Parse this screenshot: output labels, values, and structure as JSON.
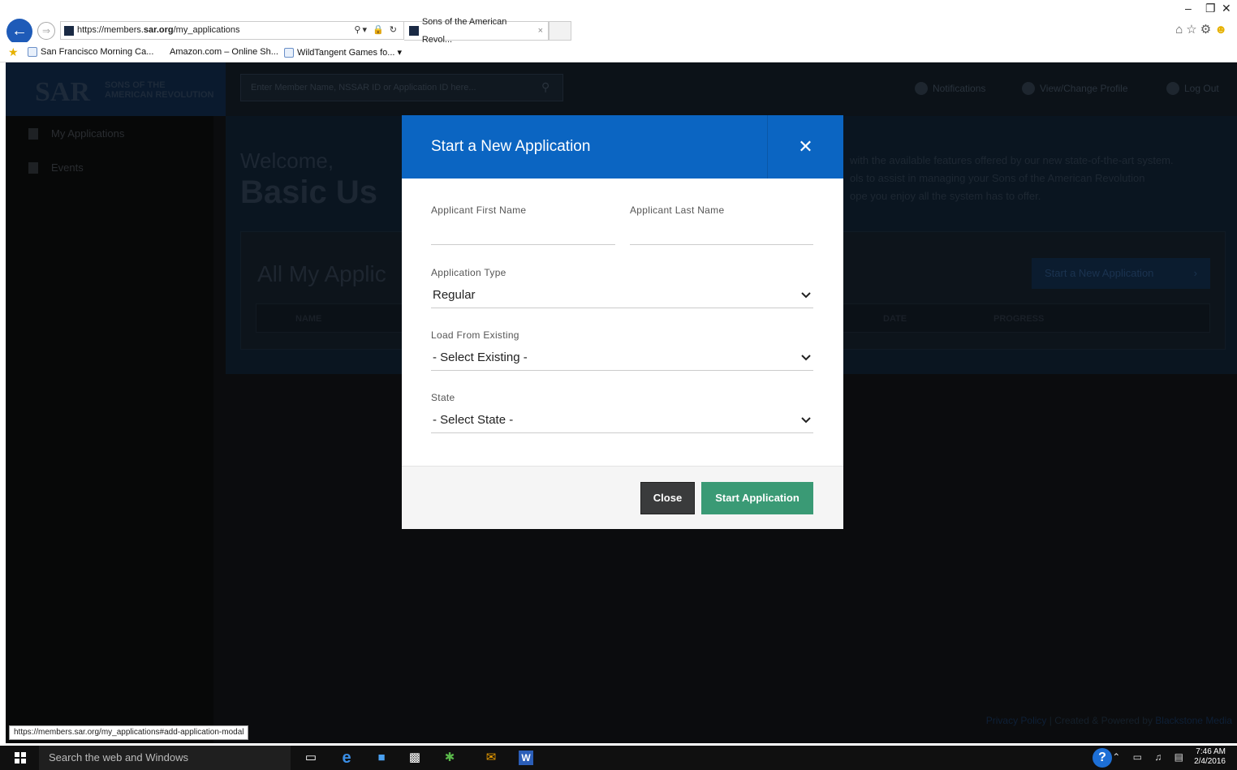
{
  "browser": {
    "url_prefix": "https://members.",
    "url_domain": "sar.org",
    "url_path": "/my_applications",
    "tab_title": "Sons of the American Revol...",
    "favorites": [
      "San Francisco Morning Ca...",
      "Amazon.com – Online Sh...",
      "WildTangent Games fo..."
    ],
    "status_link": "https://members.sar.org/my_applications#add-application-modal"
  },
  "header": {
    "logo_text": "SAR",
    "logo_sub_1": "SONS OF THE",
    "logo_sub_2": "AMERICAN REVOLUTION",
    "search_placeholder": "Enter Member Name, NSSAR ID or Application ID here...",
    "notifications": "Notifications",
    "profile": "View/Change Profile",
    "logout": "Log Out"
  },
  "sidebar": {
    "items": [
      {
        "label": "My Applications"
      },
      {
        "label": "Events"
      }
    ]
  },
  "main": {
    "welcome": "Welcome,",
    "user": "Basic Us",
    "intro_1": "with the available features offered by our new state-of-the-art system.",
    "intro_2": "ols to assist in managing your Sons of the American Revolution",
    "intro_3": "ope you enjoy all the system has to offer.",
    "card_title": "All My Applic",
    "card_button": "Start a New Application",
    "columns": [
      "NAME",
      "DATE",
      "PROGRESS"
    ],
    "footer_policy": "Privacy Policy",
    "footer_credit": " | Created & Powered by ",
    "footer_company": "Blackstone Media"
  },
  "modal": {
    "title": "Start a New Application",
    "first_name_label": "Applicant First Name",
    "first_name_value": "",
    "last_name_label": "Applicant Last Name",
    "last_name_value": "",
    "type_label": "Application Type",
    "type_value": "Regular",
    "existing_label": "Load From Existing",
    "existing_value": "- Select Existing -",
    "state_label": "State",
    "state_value": "- Select State -",
    "close_label": "Close",
    "start_label": "Start Application"
  },
  "taskbar": {
    "search_placeholder": "Search the web and Windows",
    "time": "7:46 AM",
    "date": "2/4/2016"
  },
  "colors": {
    "modal_header": "#0b65c2",
    "start_button": "#3a9a75",
    "close_button": "#3a3b3c"
  }
}
